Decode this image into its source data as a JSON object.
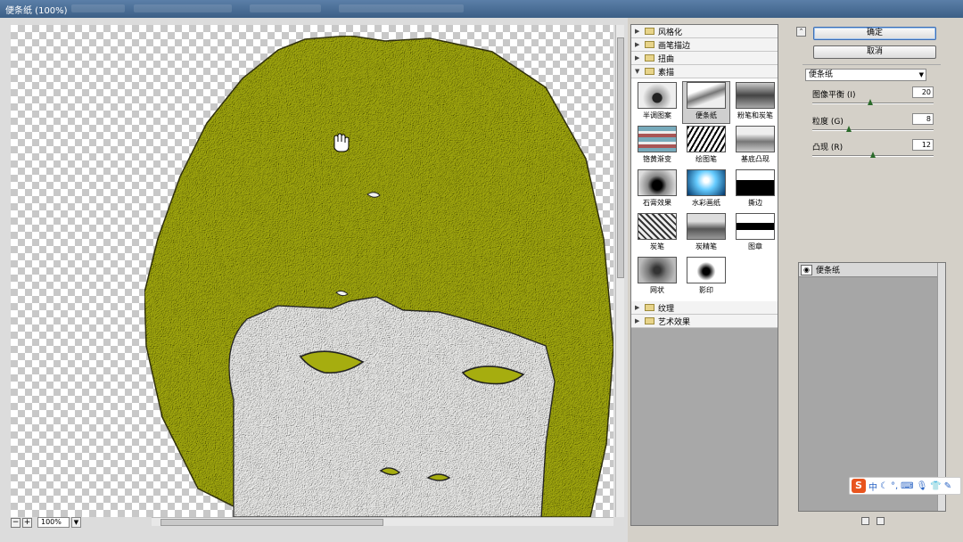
{
  "window": {
    "title": "便条纸 (100%)"
  },
  "preview": {
    "zoom": "100%",
    "zoom_out": "−",
    "zoom_in": "+"
  },
  "categories_top": [
    {
      "label": "风格化",
      "expanded": false
    },
    {
      "label": "画笔描边",
      "expanded": false
    },
    {
      "label": "扭曲",
      "expanded": false
    },
    {
      "label": "素描",
      "expanded": true
    }
  ],
  "filters": [
    {
      "label": "半调图案"
    },
    {
      "label": "便条纸",
      "selected": true
    },
    {
      "label": "粉笔和炭笔"
    },
    {
      "label": "铬黄渐变"
    },
    {
      "label": "绘图笔"
    },
    {
      "label": "基底凸现"
    },
    {
      "label": "石膏效果"
    },
    {
      "label": "水彩画纸"
    },
    {
      "label": "撕边"
    },
    {
      "label": "炭笔"
    },
    {
      "label": "炭精笔"
    },
    {
      "label": "图章"
    },
    {
      "label": "网状"
    },
    {
      "label": "影印"
    }
  ],
  "categories_bottom": [
    {
      "label": "纹理",
      "expanded": false
    },
    {
      "label": "艺术效果",
      "expanded": false
    }
  ],
  "buttons": {
    "ok": "确定",
    "cancel": "取消"
  },
  "filter_select": {
    "value": "便条纸"
  },
  "params": [
    {
      "label": "图像平衡 (I)",
      "value": "20",
      "position": 0.48
    },
    {
      "label": "粒度 (G)",
      "value": "8",
      "position": 0.3
    },
    {
      "label": "凸现 (R)",
      "value": "12",
      "position": 0.5
    }
  ],
  "layers": [
    {
      "label": "便条纸"
    }
  ],
  "ime": {
    "logo": "S",
    "lang": "中"
  },
  "colors": {
    "hair": "#a6ad0f",
    "skin": "#f2f2f0",
    "accent": "#3b6db4"
  }
}
